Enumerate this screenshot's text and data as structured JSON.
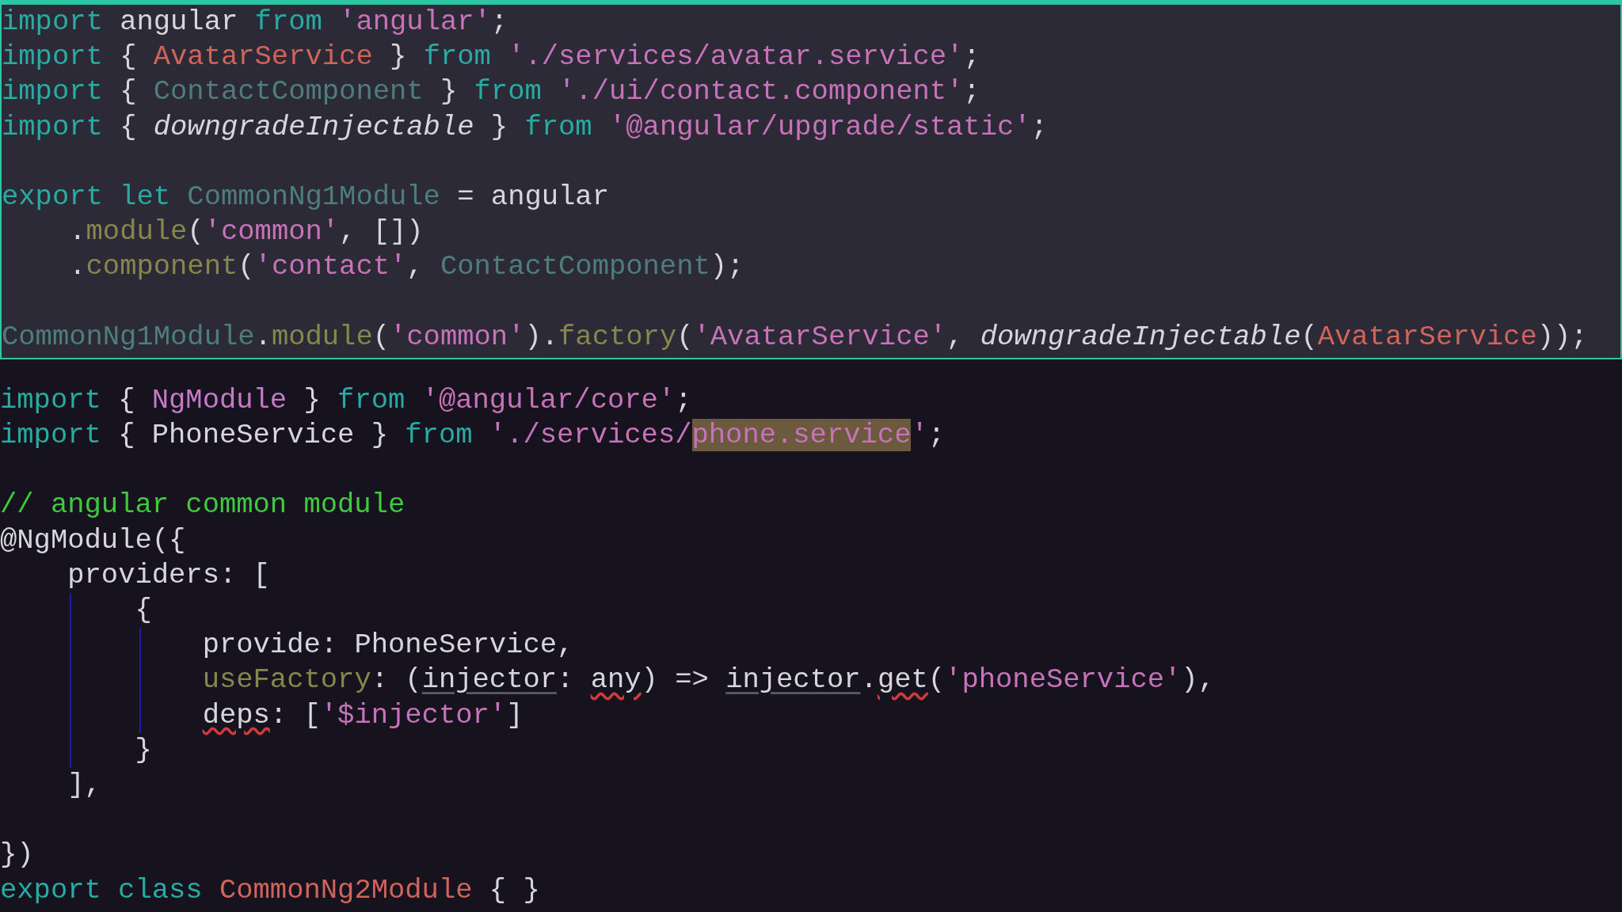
{
  "panels": [
    {
      "kind": "focused",
      "blocks": [
        {
          "lines": [
            {
              "tokens": [
                {
                  "text": "import",
                  "kind": "keyword"
                },
                {
                  "text": " angular ",
                  "kind": "plain"
                },
                {
                  "text": "from ",
                  "kind": "keyword"
                },
                {
                  "text": "'angular'",
                  "kind": "string"
                },
                {
                  "text": ";",
                  "kind": "plain"
                }
              ]
            },
            {
              "tokens": [
                {
                  "text": "import",
                  "kind": "keyword"
                },
                {
                  "text": " { ",
                  "kind": "plain"
                },
                {
                  "text": "AvatarService",
                  "kind": "type"
                },
                {
                  "text": " } ",
                  "kind": "plain"
                },
                {
                  "text": "from ",
                  "kind": "keyword"
                },
                {
                  "text": "'./services/avatar.service'",
                  "kind": "string"
                },
                {
                  "text": ";",
                  "kind": "plain"
                }
              ]
            },
            {
              "tokens": [
                {
                  "text": "import",
                  "kind": "keyword"
                },
                {
                  "text": " { ",
                  "kind": "plain"
                },
                {
                  "text": "ContactComponent",
                  "kind": "class"
                },
                {
                  "text": " } ",
                  "kind": "plain"
                },
                {
                  "text": "from ",
                  "kind": "keyword"
                },
                {
                  "text": "'./ui/contact.component'",
                  "kind": "string"
                },
                {
                  "text": ";",
                  "kind": "plain"
                }
              ]
            },
            {
              "tokens": [
                {
                  "text": "import",
                  "kind": "keyword"
                },
                {
                  "text": " { ",
                  "kind": "plain"
                },
                {
                  "text": "downgradeInjectable",
                  "kind": "italic"
                },
                {
                  "text": " } ",
                  "kind": "plain"
                },
                {
                  "text": "from ",
                  "kind": "keyword"
                },
                {
                  "text": "'@angular/upgrade/static'",
                  "kind": "string"
                },
                {
                  "text": ";",
                  "kind": "plain"
                }
              ]
            }
          ]
        },
        {
          "lines": [
            {
              "tokens": [
                {
                  "text": "export let ",
                  "kind": "keyword"
                },
                {
                  "text": "CommonNg1Module",
                  "kind": "class"
                },
                {
                  "text": " = angular",
                  "kind": "plain"
                }
              ]
            },
            {
              "tokens": [
                {
                  "text": "    .",
                  "kind": "plain"
                },
                {
                  "text": "module",
                  "kind": "method"
                },
                {
                  "text": "(",
                  "kind": "plain"
                },
                {
                  "text": "'common'",
                  "kind": "string"
                },
                {
                  "text": ", [])",
                  "kind": "plain"
                }
              ]
            },
            {
              "tokens": [
                {
                  "text": "    .",
                  "kind": "plain"
                },
                {
                  "text": "component",
                  "kind": "method"
                },
                {
                  "text": "(",
                  "kind": "plain"
                },
                {
                  "text": "'contact'",
                  "kind": "string"
                },
                {
                  "text": ", ",
                  "kind": "plain"
                },
                {
                  "text": "ContactComponent",
                  "kind": "class"
                },
                {
                  "text": ");",
                  "kind": "plain"
                }
              ]
            }
          ]
        },
        {
          "lines": [
            {
              "tokens": [
                {
                  "text": "CommonNg1Module",
                  "kind": "class"
                },
                {
                  "text": ".",
                  "kind": "plain"
                },
                {
                  "text": "module",
                  "kind": "method"
                },
                {
                  "text": "(",
                  "kind": "plain"
                },
                {
                  "text": "'common'",
                  "kind": "string"
                },
                {
                  "text": ").",
                  "kind": "plain"
                },
                {
                  "text": "factory",
                  "kind": "method"
                },
                {
                  "text": "(",
                  "kind": "plain"
                },
                {
                  "text": "'AvatarService'",
                  "kind": "string"
                },
                {
                  "text": ", ",
                  "kind": "plain"
                },
                {
                  "text": "downgradeInjectable",
                  "kind": "italic"
                },
                {
                  "text": "(",
                  "kind": "plain"
                },
                {
                  "text": "AvatarService",
                  "kind": "type"
                },
                {
                  "text": "));",
                  "kind": "plain"
                }
              ]
            }
          ]
        }
      ]
    },
    {
      "kind": "plain",
      "blocks": [
        {
          "lines": [
            {
              "tokens": [
                {
                  "text": "import",
                  "kind": "keyword"
                },
                {
                  "text": " { ",
                  "kind": "plain"
                },
                {
                  "text": "NgModule",
                  "kind": "symbol"
                },
                {
                  "text": " } ",
                  "kind": "plain"
                },
                {
                  "text": "from ",
                  "kind": "keyword"
                },
                {
                  "text": "'@angular/core'",
                  "kind": "string"
                },
                {
                  "text": ";",
                  "kind": "plain"
                }
              ]
            },
            {
              "tokens": [
                {
                  "text": "import",
                  "kind": "keyword"
                },
                {
                  "text": " { PhoneService } ",
                  "kind": "plain"
                },
                {
                  "text": "from ",
                  "kind": "keyword"
                },
                {
                  "text": "'./services/",
                  "kind": "string"
                },
                {
                  "text": "phone.service",
                  "kind": "string",
                  "highlighted": true
                },
                {
                  "text": "'",
                  "kind": "string"
                },
                {
                  "text": ";",
                  "kind": "plain"
                }
              ]
            }
          ]
        },
        {
          "lines": [
            {
              "tokens": [
                {
                  "text": "// angular common module",
                  "kind": "comment"
                }
              ]
            },
            {
              "tokens": [
                {
                  "text": "@NgModule({",
                  "kind": "plain"
                }
              ]
            },
            {
              "tokens": [
                {
                  "text": "    providers: [",
                  "kind": "plain"
                }
              ]
            },
            {
              "outer_guide": true,
              "tokens": [
                {
                  "text": "        {",
                  "kind": "plain"
                }
              ]
            },
            {
              "outer_guide": true,
              "inner_guide": true,
              "tokens": [
                {
                  "text": "            provide: PhoneService,",
                  "kind": "plain"
                }
              ]
            },
            {
              "outer_guide": true,
              "inner_guide": true,
              "tokens": [
                {
                  "text": "            useFactory",
                  "kind": "method"
                },
                {
                  "text": ": (",
                  "kind": "plain"
                },
                {
                  "text": "injector",
                  "kind": "plain",
                  "hint_underline": true
                },
                {
                  "text": ": ",
                  "kind": "plain"
                },
                {
                  "text": "any",
                  "kind": "plain",
                  "error_underline": true
                },
                {
                  "text": ") => ",
                  "kind": "plain"
                },
                {
                  "text": "injector",
                  "kind": "plain",
                  "hint_underline": true
                },
                {
                  "text": ".",
                  "kind": "plain"
                },
                {
                  "text": "get",
                  "kind": "plain",
                  "error_underline": true
                },
                {
                  "text": "(",
                  "kind": "plain"
                },
                {
                  "text": "'phoneService'",
                  "kind": "string"
                },
                {
                  "text": "),",
                  "kind": "plain"
                }
              ]
            },
            {
              "outer_guide": true,
              "inner_guide": true,
              "tokens": [
                {
                  "text": "            deps",
                  "kind": "plain",
                  "error_underline": true
                },
                {
                  "text": ": [",
                  "kind": "plain"
                },
                {
                  "text": "'$injector'",
                  "kind": "string"
                },
                {
                  "text": "]",
                  "kind": "plain"
                }
              ]
            },
            {
              "outer_guide": true,
              "tokens": [
                {
                  "text": "        }",
                  "kind": "plain"
                }
              ]
            },
            {
              "tokens": [
                {
                  "text": "    ],",
                  "kind": "plain"
                }
              ]
            }
          ]
        },
        {
          "lines": [
            {
              "tokens": [
                {
                  "text": "})",
                  "kind": "plain"
                }
              ]
            },
            {
              "tokens": [
                {
                  "text": "export class ",
                  "kind": "keyword"
                },
                {
                  "text": "CommonNg2Module",
                  "kind": "type"
                },
                {
                  "text": " { }",
                  "kind": "plain"
                }
              ]
            }
          ]
        }
      ]
    }
  ]
}
